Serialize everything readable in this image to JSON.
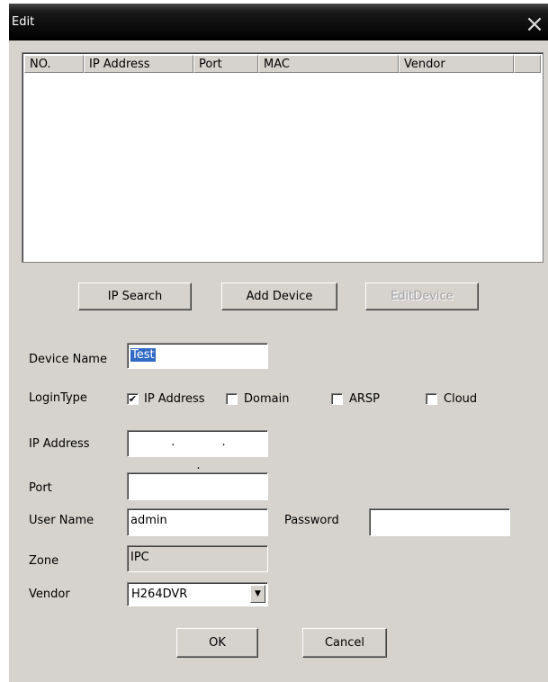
{
  "window": {
    "title": "Edit",
    "close_glyph": "×"
  },
  "device_list": {
    "columns": [
      "NO.",
      "IP Address",
      "Port",
      "MAC",
      "Vendor",
      ""
    ],
    "rows": []
  },
  "buttons": {
    "ip_search": "IP Search",
    "add_device": "Add Device",
    "edit_device": "EditDevice",
    "ok": "OK",
    "cancel": "Cancel"
  },
  "form": {
    "device_name": {
      "label": "Device Name",
      "value": "Test"
    },
    "login_type": {
      "label": "LoginType",
      "options": [
        {
          "label": "IP Address",
          "checked": true
        },
        {
          "label": "Domain",
          "checked": false
        },
        {
          "label": "ARSP",
          "checked": false
        },
        {
          "label": "Cloud",
          "checked": false
        }
      ]
    },
    "ip_address": {
      "label": "IP Address",
      "value": ". . ."
    },
    "port": {
      "label": "Port",
      "value": ""
    },
    "user_name": {
      "label": "User Name",
      "value": "admin"
    },
    "password": {
      "label": "Password",
      "value": ""
    },
    "zone": {
      "label": "Zone",
      "value": "IPC"
    },
    "vendor": {
      "label": "Vendor",
      "value": "H264DVR"
    }
  },
  "icons": {
    "close": "close-icon",
    "check": "check-icon",
    "dropdown": "chevron-down-icon"
  }
}
